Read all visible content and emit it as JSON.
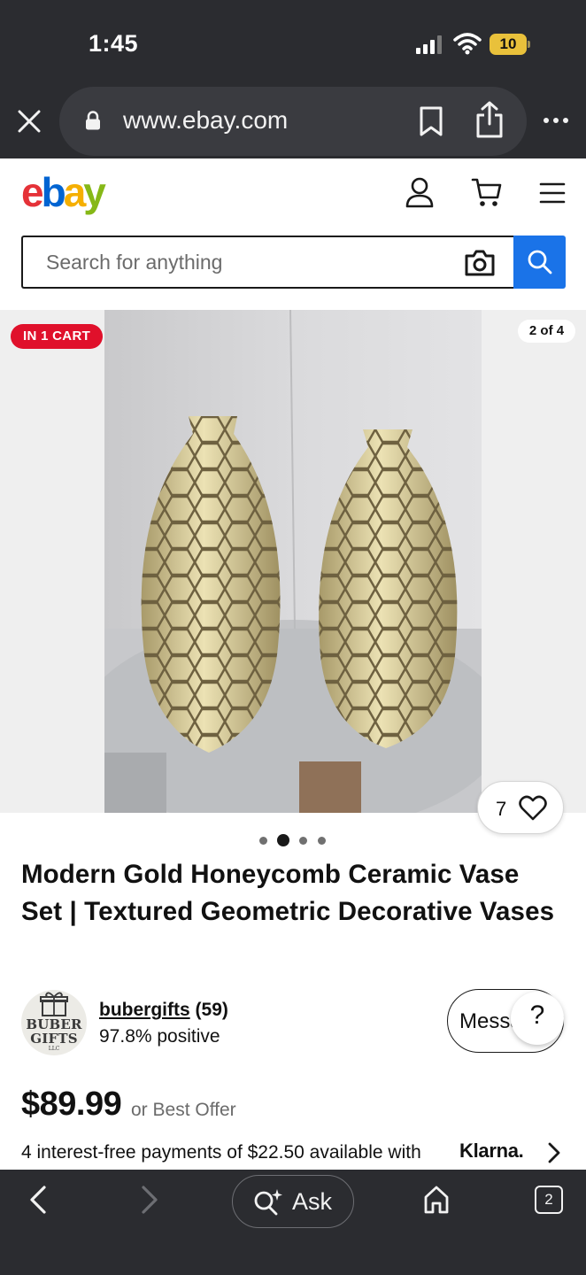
{
  "status_bar": {
    "time": "1:45",
    "battery": "10",
    "icons": [
      "signal-icon",
      "wifi-icon",
      "battery-icon"
    ]
  },
  "browser": {
    "url": "www.ebay.com",
    "icons": [
      "close-icon",
      "lock-icon",
      "bookmark-icon",
      "share-icon",
      "more-icon"
    ]
  },
  "header": {
    "logo_letters": [
      "e",
      "b",
      "a",
      "y"
    ],
    "logo_colors": [
      "#e53238",
      "#0064d2",
      "#f5af02",
      "#86b817"
    ],
    "icons": [
      "user-icon",
      "cart-icon",
      "menu-icon"
    ]
  },
  "search": {
    "placeholder": "Search for anything",
    "accent": "#1a73e8",
    "icons": [
      "camera-icon",
      "search-icon"
    ]
  },
  "gallery": {
    "cart_badge": "IN 1 CART",
    "counter": "2 of 4",
    "watch_count": "7",
    "dots_total": 4,
    "active_dot": 2,
    "badge_color": "#e0102b"
  },
  "listing": {
    "title": "Modern Gold Honeycomb Ceramic Vase Set | Textured Geometric Decorative Vases"
  },
  "seller": {
    "avatar_line1": "BUBER",
    "avatar_line2": "GIFTS",
    "avatar_llc": "LLC",
    "name": "bubergifts",
    "feedback_count": "(59)",
    "positive": "97.8% positive",
    "message_label": "Message",
    "help_label": "?"
  },
  "price": {
    "amount": "$89.99",
    "offer_text": "or Best Offer",
    "klarna_text": "4 interest-free payments of $22.50 available with",
    "klarna_brand": "Klarna."
  },
  "bottom_bar": {
    "ask_label": "Ask",
    "tabs_count": "2",
    "icons": [
      "back-icon",
      "forward-icon",
      "ask-sparkle-icon",
      "home-icon",
      "tabs-icon"
    ]
  }
}
